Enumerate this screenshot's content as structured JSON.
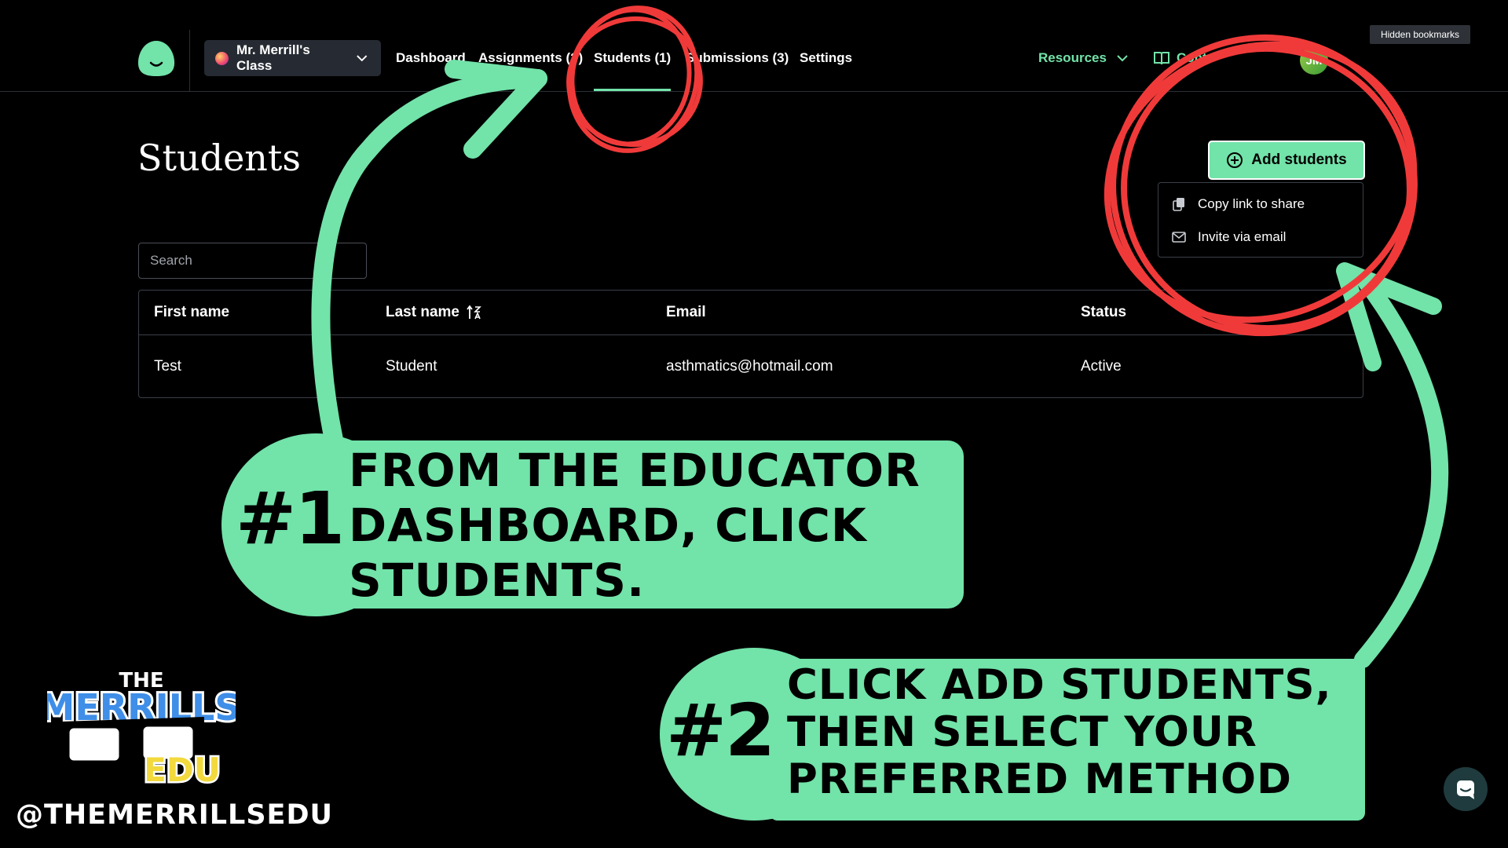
{
  "nav": {
    "class_name": "Mr. Merrill's Class",
    "items": [
      {
        "label": "Dashboard"
      },
      {
        "label": "Assignments (?)"
      },
      {
        "label": "Students (1)"
      },
      {
        "label": "Submissions (3)"
      },
      {
        "label": "Settings"
      }
    ],
    "resources_label": "Resources",
    "contact_label": "Cont",
    "avatar_initials": "JM",
    "tooltip": "Hidden bookmarks"
  },
  "page": {
    "title": "Students",
    "add_button_label": "Add students",
    "dropdown": [
      {
        "label": "Copy link to share",
        "icon": "copy-icon"
      },
      {
        "label": "Invite via email",
        "icon": "mail-icon"
      }
    ],
    "search_placeholder": "Search"
  },
  "table": {
    "headers": [
      "First name",
      "Last name",
      "Email",
      "Status"
    ],
    "rows": [
      [
        "Test",
        "Student",
        "asthmatics@hotmail.com",
        "Active"
      ]
    ]
  },
  "callouts": [
    {
      "number": "#1",
      "text": "FROM THE EDUCATOR\nDASHBOARD, CLICK\nSTUDENTS."
    },
    {
      "number": "#2",
      "text": "CLICK ADD STUDENTS,\nTHEN SELECT YOUR\nPREFERRED METHOD"
    }
  ],
  "branding": {
    "logo_text": [
      "THE",
      "MERRILLS",
      "EDU"
    ],
    "handle": "@THEMERRILLSEDU"
  },
  "colors": {
    "accent": "#72e3a9",
    "annotation_red": "#f03a3a",
    "background": "#000000"
  }
}
